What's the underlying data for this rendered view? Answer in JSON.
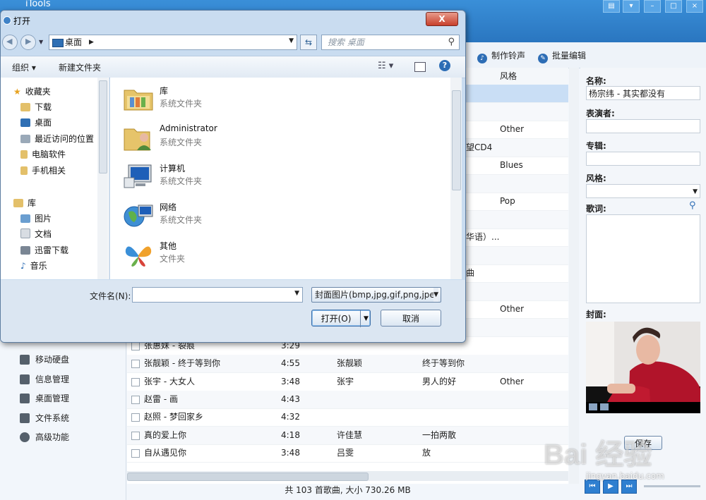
{
  "app": {
    "title": "iTools",
    "toolbar": [
      {
        "label": "制作铃声",
        "icon": "bell-icon"
      },
      {
        "label": "批量编辑",
        "icon": "edit-icon"
      }
    ],
    "sidebar": [
      {
        "label": "移动硬盘",
        "icon": "drive-icon"
      },
      {
        "label": "信息管理",
        "icon": "info-icon"
      },
      {
        "label": "桌面管理",
        "icon": "desktop-icon"
      },
      {
        "label": "文件系统",
        "icon": "folder-icon"
      },
      {
        "label": "高级功能",
        "icon": "flask-icon"
      }
    ],
    "list": {
      "header_genre": "风格",
      "upper_rows": [
        {
          "genre": "",
          "album": ""
        },
        {
          "genre": "",
          "album": ""
        },
        {
          "genre": "Other",
          "album": ""
        },
        {
          "genre": "",
          "album": "望CD4"
        },
        {
          "genre": "Blues",
          "album": ""
        },
        {
          "genre": "",
          "album": ""
        },
        {
          "genre": "Pop",
          "album": ""
        },
        {
          "genre": "",
          "album": ""
        },
        {
          "genre": "",
          "album": "华语）..."
        },
        {
          "genre": "",
          "album": ""
        },
        {
          "genre": "",
          "album": "曲"
        },
        {
          "genre": "",
          "album": ""
        },
        {
          "genre": "Other",
          "album": ""
        },
        {
          "genre": "",
          "album": ""
        }
      ],
      "rows": [
        {
          "name": "张惠妹 - 裂痕",
          "time": "3:29",
          "artist": "",
          "album": "",
          "genre": ""
        },
        {
          "name": "张靓颖 - 终于等到你",
          "time": "4:55",
          "artist": "张靓颖",
          "album": "终于等到你",
          "genre": ""
        },
        {
          "name": "张宇 - 大女人",
          "time": "3:48",
          "artist": "张宇",
          "album": "男人的好",
          "genre": "Other"
        },
        {
          "name": "赵雷 - 画",
          "time": "4:43",
          "artist": "",
          "album": "",
          "genre": ""
        },
        {
          "name": "赵照 - 梦回家乡",
          "time": "4:32",
          "artist": "",
          "album": "",
          "genre": ""
        },
        {
          "name": "真的爱上你",
          "time": "4:18",
          "artist": "许佳慧",
          "album": "一拍两散",
          "genre": ""
        },
        {
          "name": "自从遇见你",
          "time": "3:48",
          "artist": "吕雯",
          "album": "放",
          "genre": ""
        }
      ],
      "status": "共 103 首歌曲, 大小 730.26 MB"
    },
    "details": {
      "name_label": "名称:",
      "name_value": "杨宗纬 - 其实都没有",
      "performer_label": "表演者:",
      "album_label": "专辑:",
      "genre_label": "风格:",
      "lyrics_label": "歌词:",
      "cover_label": "封面:",
      "save_button": "保存"
    }
  },
  "dialog": {
    "title": "打开",
    "close_label": "X",
    "address": "桌面",
    "search_placeholder": "搜索 桌面",
    "organize": "组织",
    "new_folder": "新建文件夹",
    "help": "?",
    "nav": {
      "favorites": "收藏夹",
      "favorites_items": [
        "下载",
        "桌面",
        "最近访问的位置",
        "电脑软件",
        "手机相关"
      ],
      "libraries": "库",
      "library_items": [
        "图片",
        "文档",
        "迅雷下载",
        "音乐"
      ]
    },
    "files": [
      {
        "name": "库",
        "type": "系统文件夹",
        "icon": "library-folder-icon"
      },
      {
        "name": "Administrator",
        "type": "系统文件夹",
        "icon": "user-folder-icon"
      },
      {
        "name": "计算机",
        "type": "系统文件夹",
        "icon": "computer-icon"
      },
      {
        "name": "网络",
        "type": "系统文件夹",
        "icon": "network-globe-icon"
      },
      {
        "name": "其他",
        "type": "文件夹",
        "icon": "msn-butterfly-icon"
      }
    ],
    "filename_label": "文件名(N):",
    "filename_value": "",
    "filter": "封面图片(bmp,jpg,gif,png,jpe",
    "open_button": "打开(O)",
    "cancel_button": "取消"
  },
  "watermark": {
    "text": "Bai 经验",
    "url": "jingyan.baidu.com"
  }
}
